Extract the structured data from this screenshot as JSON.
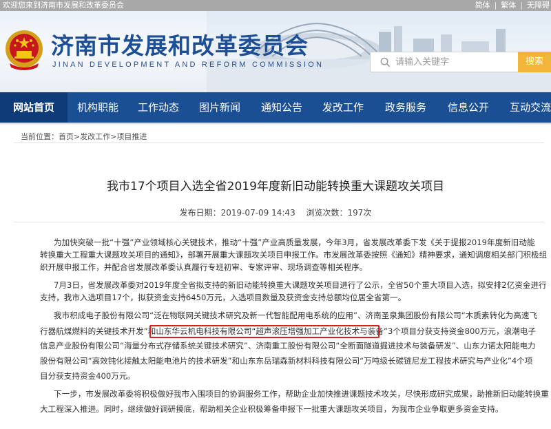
{
  "topbar": {
    "welcome": "欢迎您来到济南市发展和改革委员会",
    "langs": [
      "简体",
      "繁体",
      "无障碍"
    ]
  },
  "header": {
    "title": "济南市发展和改革委员会",
    "subtitle": "JINAN DEVELOPMENT AND REFORM COMMISSION",
    "search_placeholder": "请输入关键字",
    "search_button": "搜索"
  },
  "nav": {
    "items": [
      "网站首页",
      "机构职能",
      "工作动态",
      "图片新闻",
      "通知公告",
      "发改工作",
      "政务服务",
      "信息公开",
      "互动交流"
    ]
  },
  "breadcrumb": {
    "label": "当前位置：",
    "items": [
      "首页",
      "发改工作",
      "项目推进"
    ],
    "separator": ">"
  },
  "article": {
    "title": "我市17个项目入选全省2019年度新旧动能转换重大课题攻关项目",
    "publish_date": "发布日期：2019-07-09 14:43",
    "views": "浏览次数：197次",
    "lines": [
      "为加快突破一批“十强”产业领域核心关键技术，推动“十强”产业高质量发展，今年3月，省发展改革委下发《关于提报2019年度新旧动能",
      "转换重大工程重大课题攻关项目的通知》，部署开展重大课题攻关项目申报工作。市发展改革委按照《通知》精神要求，通知调度相关部门积极组",
      "织开展申报工作，并配合省发展改革委认真履行专班初审、专家评审、现场调查等相关程序。",
      "7月3日，省发展改革委对2019年度全省拟支持的新旧动能转换重大课题攻关项目进行了公示，全省50个重大项目入选，拟安排2亿资金进行",
      "支持，我市入选项目17个，拟获资金支持6450万元，入选项目数量及获资金支持总额均位居全省第一。",
      "我市积成电子股份有限公司“泛在物联网关键技术研究及新一代智能配用电系统的应用”、济南圣泉集团股份有限公司“木质素转化为高速飞",
      "行器航煤燃料的关键技术开发”和山东华云机电科技有限公司“超声滚压增强加工产业化技术与装备”3个项目分获支持资金800万元，浪潮电子",
      "信息产业股份有限公司“海量分布式存储系统关键技术研究”、济南重工股份有限公司“全断面隧道掘进技术与装备研发”、山东力诺太阳能电力",
      "股份有限公司“高效钝化接触太阳能电池片的技术研发”和山东东岳瑞森新材料科技有限公司“万吨级长碳链尼龙工程技术研究与产业化”4个项",
      "目分获支持资金400万元。",
      "下一步，市发展改革委将积极做好我市入围项目的协调服务工作，帮助企业加快推进课题技术攻关，尽快形成研究成果，助推新旧动能转换重",
      "大工程深入推进。同时，继续做好调研摸底，帮助相关企业积极筹备申报下一批重大课题攻关项目，为我市企业争取更多资金支持。"
    ]
  },
  "colors": {
    "nav_bg": "#1b4f93",
    "nav_active": "#0e3c78",
    "title_blue": "#1d4f96",
    "search_button": "#f3b43a",
    "highlight": "#d81e1e"
  }
}
